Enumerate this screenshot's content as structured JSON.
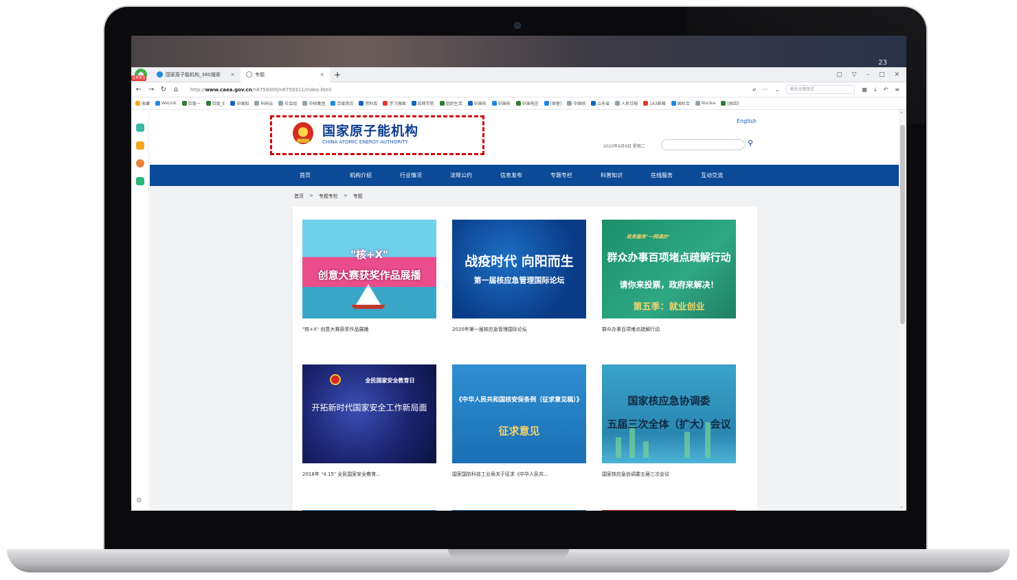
{
  "browser": {
    "tabs": [
      {
        "label": "国家原子能机构_360搜索",
        "active": false
      },
      {
        "label": "专题",
        "active": true
      }
    ],
    "badge": "注意安全",
    "wallpaper_number": "23",
    "url_prefix": "http://",
    "url_domain": "www.caea.gov.cn",
    "url_path": "/n6759300/n6759311/index.html",
    "search_placeholder": "刚天全面用车",
    "bookmarks": [
      "收藏",
      "WeLink",
      "百度一",
      "百度_E",
      "中国知",
      "科研云",
      "社会组",
      "中核集团",
      "百度首页",
      "资料库",
      "学习强国",
      "知网学院",
      "组织生活",
      "中国核",
      "中国核",
      "中国电信",
      "[保留]",
      "中国核",
      "山东省",
      "人民日报",
      "163邮箱",
      "国际合",
      "Nuclea",
      "[原因]"
    ]
  },
  "site": {
    "org_name_cn": "国家原子能机构",
    "org_name_en": "CHINA ATOMIC ENERGY AUTHORITY",
    "language_link": "English",
    "date_text": "2020年6月9日 星期二",
    "nav": [
      "首页",
      "机构介绍",
      "行业情况",
      "法规公约",
      "信息发布",
      "专题专栏",
      "科普知识",
      "在线服务",
      "互动交流"
    ],
    "breadcrumb": [
      "首页",
      "专题专栏",
      "专题"
    ],
    "breadcrumb_sep": ">"
  },
  "cards": [
    {
      "thumb_title": "\"核+X\"",
      "thumb_sub": "创意大赛获奖作品展播",
      "caption": "\"核+X\" 创意大赛获奖作品展播"
    },
    {
      "thumb_title": "战疫时代 向阳而生",
      "thumb_sub": "第一届核应急管理国际论坛",
      "caption": "2020年第一届核应急管理国际论坛"
    },
    {
      "thumb_title": "群众办事百项堵点疏解行动",
      "thumb_sub": "请你来投票，政府来解决！",
      "thumb_kicker": "政务服务\"一网通办\"",
      "thumb_extra": "第五季：就业创业",
      "caption": "群众办事百项堵点疏解行动"
    },
    {
      "thumb_title": "开拓新时代国家安全工作新局面",
      "thumb_sub": "全民国家安全教育日",
      "caption": "2018年 \"4.15\" 全民国家安全教育..."
    },
    {
      "thumb_title": "《中华人民共和国核安保条例（征求意见稿）》",
      "thumb_sub": "征求意见",
      "caption": "国家国防科技工业局关于征求《中华人民共..."
    },
    {
      "thumb_title": "国家核应急协调委",
      "thumb_sub": "五届三次全体（扩大）会议",
      "caption": "国家核应急协调委五届三次会议"
    }
  ],
  "colors": {
    "nav_blue": "#0a4a97",
    "highlight_red": "#d00000",
    "brand_blue": "#0b3d91"
  }
}
